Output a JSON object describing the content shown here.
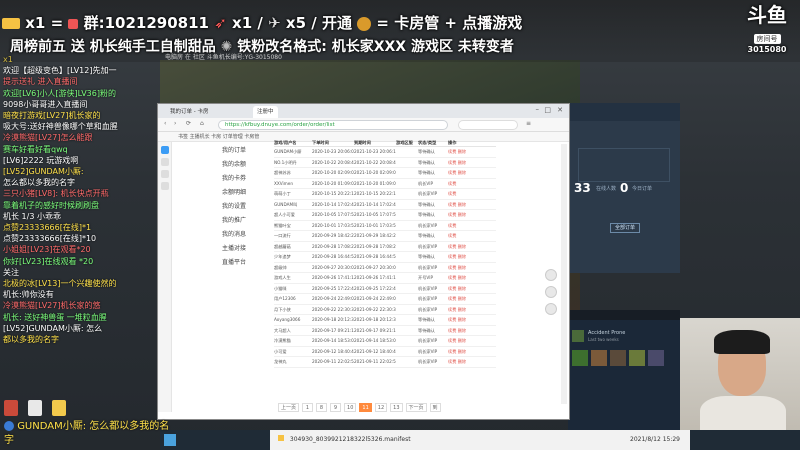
{
  "overlay": {
    "line1": "x1 = 粉群:1021290811  x1 / x5 / 开通 = 卡房管 + 点播游戏",
    "line1_a": "x1 =",
    "line1_b": "群:1021290811",
    "line1_c": "x1 /",
    "line1_d": "x5 / 开通",
    "line1_e": "= 卡房管 + 点播游戏",
    "line2_a": "周榜前五 送 机长纯手工自制甜品",
    "line2_b": "铁粉改名格式: 机长家XXX 游戏区 未转变者",
    "sub_line": "电脑房 在  社区  斗鱼机长编号:YG-3015080"
  },
  "logo": {
    "brand": "斗鱼",
    "sub": "房间号",
    "room": "3015080"
  },
  "chat": [
    "x1",
    "欢迎【超级变色】[LV12]先加一",
    "提示送礼 进入直播间",
    "欢迎[LV6]小人[游侠]LV36]粉的",
    "9098小哥哥进入直播间",
    "暗夜打游戏[LV27]机长家的",
    "吸大号:送好神兽像哪个草和血腥",
    "冷漠熊猫[LV27]怎么能跟",
    "赛车好看好看qwq",
    "[LV6]2222 玩游戏啊",
    "[LV52]GUNDAM小厮:",
    "怎么都以多我的名字",
    "三只小猪[LV8]: 机长快点开瓶",
    "靠着机子的感好时候刷刷盘",
    "机长 1/3 小乖乖",
    "点赞23333666[在线]*1",
    "点赞23333666[在线]*10",
    "小姐姐[LV23]在观看*20",
    "你好[LV23]在线观看 *20",
    "关注",
    "北极的冰[LV13]一个兴趣使然的",
    "机长:帅你没有",
    "冷漠熊猫[LV27]机长家的悠",
    "机长: 送好神兽蛋 一堆粒血腥",
    "[LV52]GUNDAM小厮: 怎么",
    "都以多我的名字"
  ],
  "bottom_chat": "GUNDAM小厮: 怎么都以多我的名字",
  "browser": {
    "tab_title": "我的订单 - 卡房",
    "tab2": "注册中",
    "url": "https://kfbuy.dnuye.com/order/order/list",
    "bookmarks": "书签  主播机长  卡房  订单管理  卡房管",
    "site_brand": "点播游戏",
    "side_items": [
      "我的订单",
      "我的余额",
      "我的卡券",
      "余额明细",
      "我的设置",
      "我的推广",
      "我的消息",
      "主播对接",
      "直播平台"
    ],
    "columns": [
      "游戏/用户名",
      "下单时间",
      "到期时间",
      "游戏区服",
      "状态/类型",
      "操作"
    ],
    "rows": [
      [
        "GUNDAM小厮",
        "2020-10-23 20:06:01",
        "2021-10-23 20:06:15",
        "",
        "等待确认",
        "续费 删除"
      ],
      [
        "NO.1小明丹",
        "2020-10-22 20:08:42",
        "2021-10-22 20:08:42",
        "",
        "等待确认",
        "续费 删除"
      ],
      [
        "超神苏苏",
        "2020-10-20 02:09:01",
        "2021-10-20 02:09:01",
        "",
        "等待确认",
        "续费 删除"
      ],
      [
        "XXVimen",
        "2020-10-20 01:09:02",
        "2021-10-20 01:09:02",
        "",
        "机长VIP",
        "续费"
      ],
      [
        "萌萌小丁",
        "2020-10-15 20:22:10",
        "2021-10-15 20:22:10",
        "",
        "机长家VIP",
        "续费"
      ],
      [
        "GUNDAM叫",
        "2020-10-14 17:02:44",
        "2021-10-14 17:02:44",
        "",
        "等待确认",
        "续费 删除"
      ],
      [
        "超人小可爱",
        "2020-10-05 17:07:58",
        "2021-10-05 17:07:58",
        "",
        "等待确认",
        "续费 删除"
      ],
      [
        "熊猫叶宝",
        "2020-10-01 17:03:51",
        "2021-10-01 17:03:51",
        "",
        "机长家VIP",
        "续费"
      ],
      [
        "一口流行",
        "2020-09-29 18:42:22",
        "2021-09-29 18:42:22",
        "",
        "等待确认",
        "续费"
      ],
      [
        "超越蘑菇",
        "2020-09-28 17:08:27",
        "2021-09-28 17:08:27",
        "",
        "机长家VIP",
        "续费 删除"
      ],
      [
        "少年追梦",
        "2020-09-28 16:44:55",
        "2021-09-28 16:44:55",
        "",
        "等待确认",
        "续费 删除"
      ],
      [
        "超级帅",
        "2020-09-27 20:30:07",
        "2021-09-27 20:30:07",
        "",
        "机长家VIP",
        "续费 删除"
      ],
      [
        "游戏人生",
        "2020-09-26 17:41:10",
        "2021-09-26 17:41:10",
        "",
        "开号VIP",
        "续费 删除"
      ],
      [
        "小猫咪",
        "2020-09-25 17:22:46",
        "2021-09-25 17:22:46",
        "",
        "机长家VIP",
        "续费 删除"
      ],
      [
        "用户12306",
        "2020-09-24 22:49:04",
        "2021-09-24 22:49:04",
        "",
        "机长家VIP",
        "续费 删除"
      ],
      [
        "月下小侠",
        "2020-09-22 22:30:33",
        "2021-09-22 22:30:33",
        "",
        "机长家VIP",
        "续费 删除"
      ],
      [
        "Aoyang3066",
        "2020-09-18 20:12:35",
        "2021-09-18 20:12:35",
        "",
        "等待确认",
        "续费 删除"
      ],
      [
        "大马超人",
        "2020-09-17 09:21:12",
        "2021-09-17 09:21:12",
        "",
        "等待确认",
        "续费 删除"
      ],
      [
        "冷漠熊猫",
        "2020-09-14 18:53:01",
        "2021-09-14 18:53:01",
        "",
        "机长家VIP",
        "续费 删除"
      ],
      [
        "小可爱",
        "2020-09-12 18:40:47",
        "2021-09-12 18:40:47",
        "",
        "机长家VIP",
        "续费 删除"
      ],
      [
        "龙神丸",
        "2020-09-11 22:02:56",
        "2021-09-11 22:02:56",
        "",
        "机长家VIP",
        "续费 删除"
      ]
    ],
    "pager": [
      "上一页",
      "1",
      "8",
      "9",
      "10",
      "11",
      "12",
      "13",
      "下一页",
      "到"
    ],
    "pager_active": "11"
  },
  "darkapp": {
    "stat1": "33",
    "stat1_label": "在线人数",
    "stat2": "0",
    "stat2_label": "今日订单",
    "btn": "全部订单"
  },
  "steam": {
    "title": "Accident Prone",
    "sub": "Last two weeks"
  },
  "download": {
    "file": "304930_8039921218322l5326.manifest",
    "size": "2021/8/12 15:29"
  },
  "colors": {
    "accent": "#ff8a3d",
    "chat_red": "#ff6a6a",
    "chat_yellow": "#ffe14a",
    "chat_green": "#7cff7c"
  }
}
